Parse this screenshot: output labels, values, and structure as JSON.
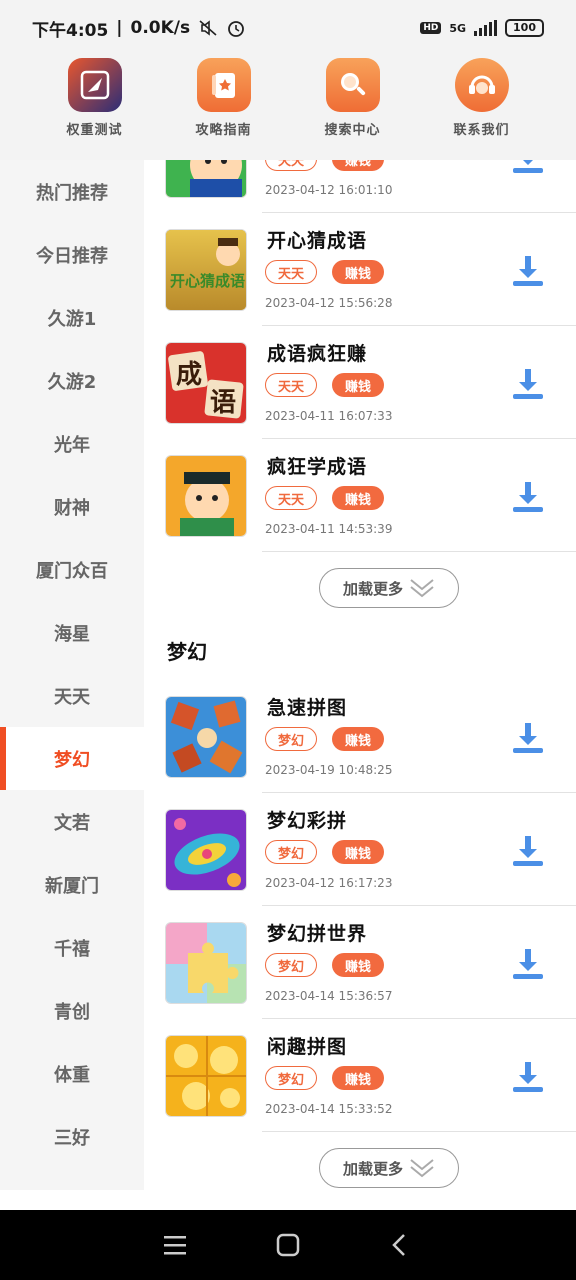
{
  "status": {
    "time": "下午4:05",
    "speed": "0.0K/s",
    "hd": "HD",
    "network": "5G",
    "battery": "100"
  },
  "topnav": [
    {
      "label": "权重测试",
      "icon": "compass-icon",
      "color": "#e2562f"
    },
    {
      "label": "攻略指南",
      "icon": "guide-book-icon",
      "color": "#f28a45"
    },
    {
      "label": "搜索中心",
      "icon": "search-icon",
      "color": "#f28a45"
    },
    {
      "label": "联系我们",
      "icon": "headset-icon",
      "color": "#f28a45"
    }
  ],
  "sidebar": {
    "items": [
      "热门推荐",
      "今日推荐",
      "久游1",
      "久游2",
      "光年",
      "财神",
      "厦门众百",
      "海星",
      "天天",
      "梦幻",
      "文若",
      "新厦门",
      "千禧",
      "青创",
      "体重",
      "三好"
    ],
    "active": "梦幻"
  },
  "sections": {
    "tiantian": {
      "rows": [
        {
          "name": "",
          "tag1": "天天",
          "tag2": "赚钱",
          "date": "2023-04-12  16:01:10"
        },
        {
          "name": "开心猜成语",
          "tag1": "天天",
          "tag2": "赚钱",
          "date": "2023-04-12  15:56:28"
        },
        {
          "name": "成语疯狂赚",
          "tag1": "天天",
          "tag2": "赚钱",
          "date": "2023-04-11  16:07:33"
        },
        {
          "name": "疯狂学成语",
          "tag1": "天天",
          "tag2": "赚钱",
          "date": "2023-04-11  14:53:39"
        }
      ],
      "load_more": "加载更多"
    },
    "menghuan": {
      "title": "梦幻",
      "rows": [
        {
          "name": "急速拼图",
          "tag1": "梦幻",
          "tag2": "赚钱",
          "date": "2023-04-19  10:48:25"
        },
        {
          "name": "梦幻彩拼",
          "tag1": "梦幻",
          "tag2": "赚钱",
          "date": "2023-04-12  16:17:23"
        },
        {
          "name": "梦幻拼世界",
          "tag1": "梦幻",
          "tag2": "赚钱",
          "date": "2023-04-14  15:36:57"
        },
        {
          "name": "闲趣拼图",
          "tag1": "梦幻",
          "tag2": "赚钱",
          "date": "2023-04-14  15:33:52"
        }
      ],
      "load_more": "加载更多"
    }
  },
  "thumb_text": {
    "kaixin": "开心猜成语",
    "chengyu": [
      "成",
      "语"
    ]
  }
}
